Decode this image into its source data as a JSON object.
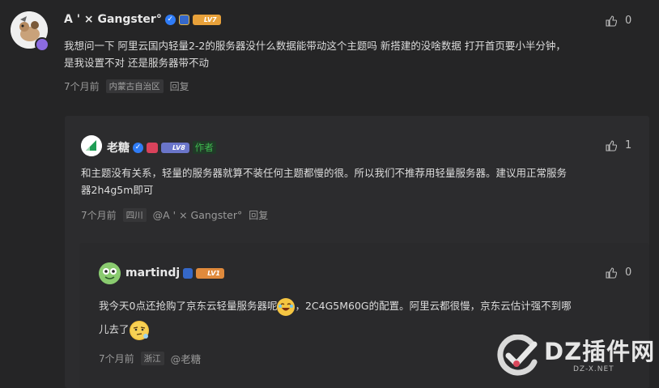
{
  "comments": [
    {
      "author": "A ' ⨯ Gangster°",
      "level": "LV7",
      "text_line1": "我想问一下 阿里云国内轻量2-2的服务器没什么数据能带动这个主题吗  新搭建的没啥数据 打开首页要小半分钟，",
      "text_line2": "是我设置不对 还是服务器带不动",
      "time": "7个月前",
      "location": "内蒙古自治区",
      "reply_label": "回复",
      "likes": "0"
    },
    {
      "author": "老糖",
      "level": "LV8",
      "author_tag": "作者",
      "text_line1": "和主题没有关系，轻量的服务器就算不装任何主题都慢的很。所以我们不推荐用轻量服务器。建议用正常服务",
      "text_line2": "器2h4g5m即可",
      "time": "7个月前",
      "location": "四川",
      "mention": "@A ' ⨯ Gangster°",
      "reply_label": "回复",
      "likes": "1"
    },
    {
      "author": "martindj",
      "level": "LV1",
      "text_part1": "我今天0点还抢购了京东云轻量服务器呢",
      "text_part2": "，2C4G5M60G的配置。阿里云都很慢，京东云估计强不到哪",
      "text_line2": "儿去了",
      "time": "7个月前",
      "location": "浙江",
      "mention": "@老糖",
      "likes": "0"
    }
  ],
  "watermark": {
    "brand": "DZ插件网",
    "url": "DZ-X.NET"
  },
  "colors": {
    "background": "#252526",
    "panel": "#2c2c2e",
    "author_tag": "#3fb950",
    "lv7": "#e8a13a",
    "lv8": "#6a75c9",
    "lv1": "#e08a3c"
  }
}
